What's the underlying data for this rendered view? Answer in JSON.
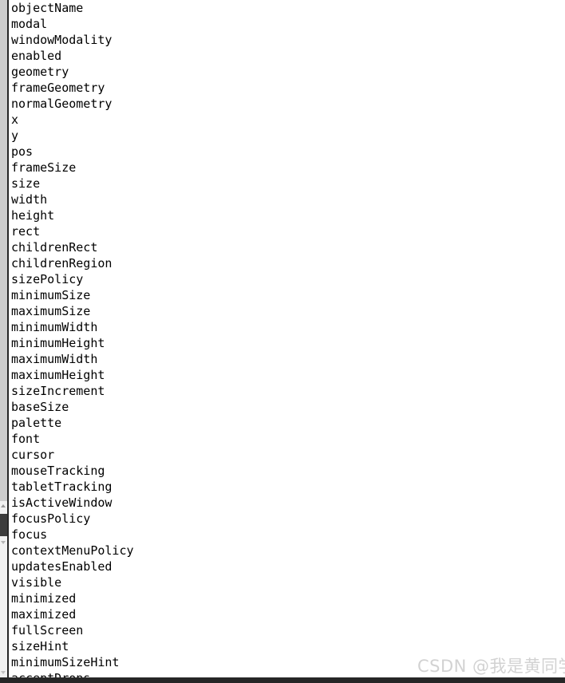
{
  "window": {
    "kind": "qt-property-editor-property-list",
    "background_color": "#ffffff",
    "text_color": "#000000"
  },
  "scrollbar_vertical": {
    "track_color": "#cdcdcd",
    "thumb_color": "#3c3c3c",
    "arrow_up_icon": "triangle-up-icon",
    "arrow_down_icon": "triangle-down-icon"
  },
  "scrollbar_horizontal": {
    "color": "#262626"
  },
  "property_list": {
    "items": [
      {
        "name": "objectName"
      },
      {
        "name": "modal"
      },
      {
        "name": "windowModality"
      },
      {
        "name": "enabled"
      },
      {
        "name": "geometry"
      },
      {
        "name": "frameGeometry"
      },
      {
        "name": "normalGeometry"
      },
      {
        "name": "x"
      },
      {
        "name": "y"
      },
      {
        "name": "pos"
      },
      {
        "name": "frameSize"
      },
      {
        "name": "size"
      },
      {
        "name": "width"
      },
      {
        "name": "height"
      },
      {
        "name": "rect"
      },
      {
        "name": "childrenRect"
      },
      {
        "name": "childrenRegion"
      },
      {
        "name": "sizePolicy"
      },
      {
        "name": "minimumSize"
      },
      {
        "name": "maximumSize"
      },
      {
        "name": "minimumWidth"
      },
      {
        "name": "minimumHeight"
      },
      {
        "name": "maximumWidth"
      },
      {
        "name": "maximumHeight"
      },
      {
        "name": "sizeIncrement"
      },
      {
        "name": "baseSize"
      },
      {
        "name": "palette"
      },
      {
        "name": "font"
      },
      {
        "name": "cursor"
      },
      {
        "name": "mouseTracking"
      },
      {
        "name": "tabletTracking"
      },
      {
        "name": "isActiveWindow"
      },
      {
        "name": "focusPolicy"
      },
      {
        "name": "focus"
      },
      {
        "name": "contextMenuPolicy"
      },
      {
        "name": "updatesEnabled"
      },
      {
        "name": "visible"
      },
      {
        "name": "minimized"
      },
      {
        "name": "maximized"
      },
      {
        "name": "fullScreen"
      },
      {
        "name": "sizeHint"
      },
      {
        "name": "minimumSizeHint"
      },
      {
        "name": "acceptDrops"
      }
    ]
  },
  "watermark": {
    "text": "CSDN @我是黄同学",
    "color": "#d2d2d2"
  }
}
